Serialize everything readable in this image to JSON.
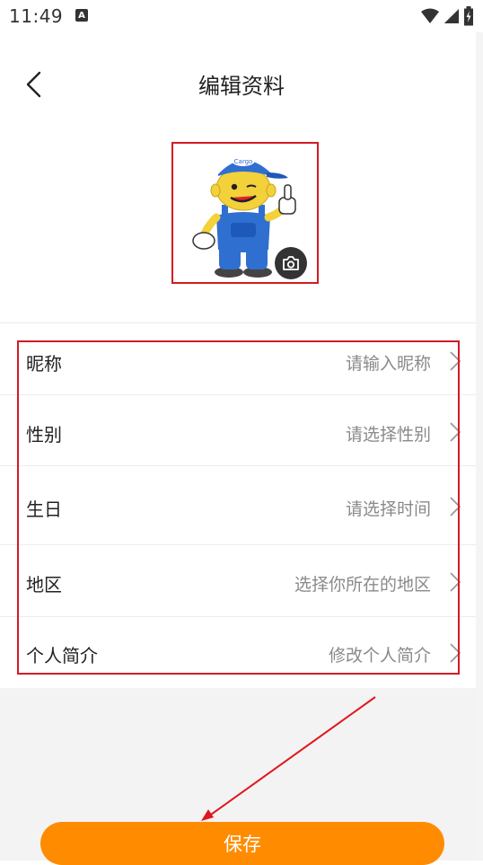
{
  "status_bar": {
    "time": "11:49",
    "notification_icon": "a-notification-icon",
    "wifi_icon": "wifi-icon",
    "signal_icon": "cell-signal-icon",
    "battery_icon": "battery-charging-icon"
  },
  "header": {
    "back_icon": "chevron-left-icon",
    "title": "编辑资料"
  },
  "avatar": {
    "cap_text": "Cargo",
    "camera_icon": "camera-icon"
  },
  "profile_rows": [
    {
      "label": "昵称",
      "value": "请输入昵称"
    },
    {
      "label": "性别",
      "value": "请选择性别"
    },
    {
      "label": "生日",
      "value": "请选择时间"
    },
    {
      "label": "地区",
      "value": "选择你所在的地区"
    },
    {
      "label": "个人简介",
      "value": "修改个人简介"
    }
  ],
  "save_button": {
    "label": "保存"
  },
  "colors": {
    "accent": "#ff8c00",
    "highlight": "#d31b23",
    "placeholder": "#8a8a8a"
  }
}
